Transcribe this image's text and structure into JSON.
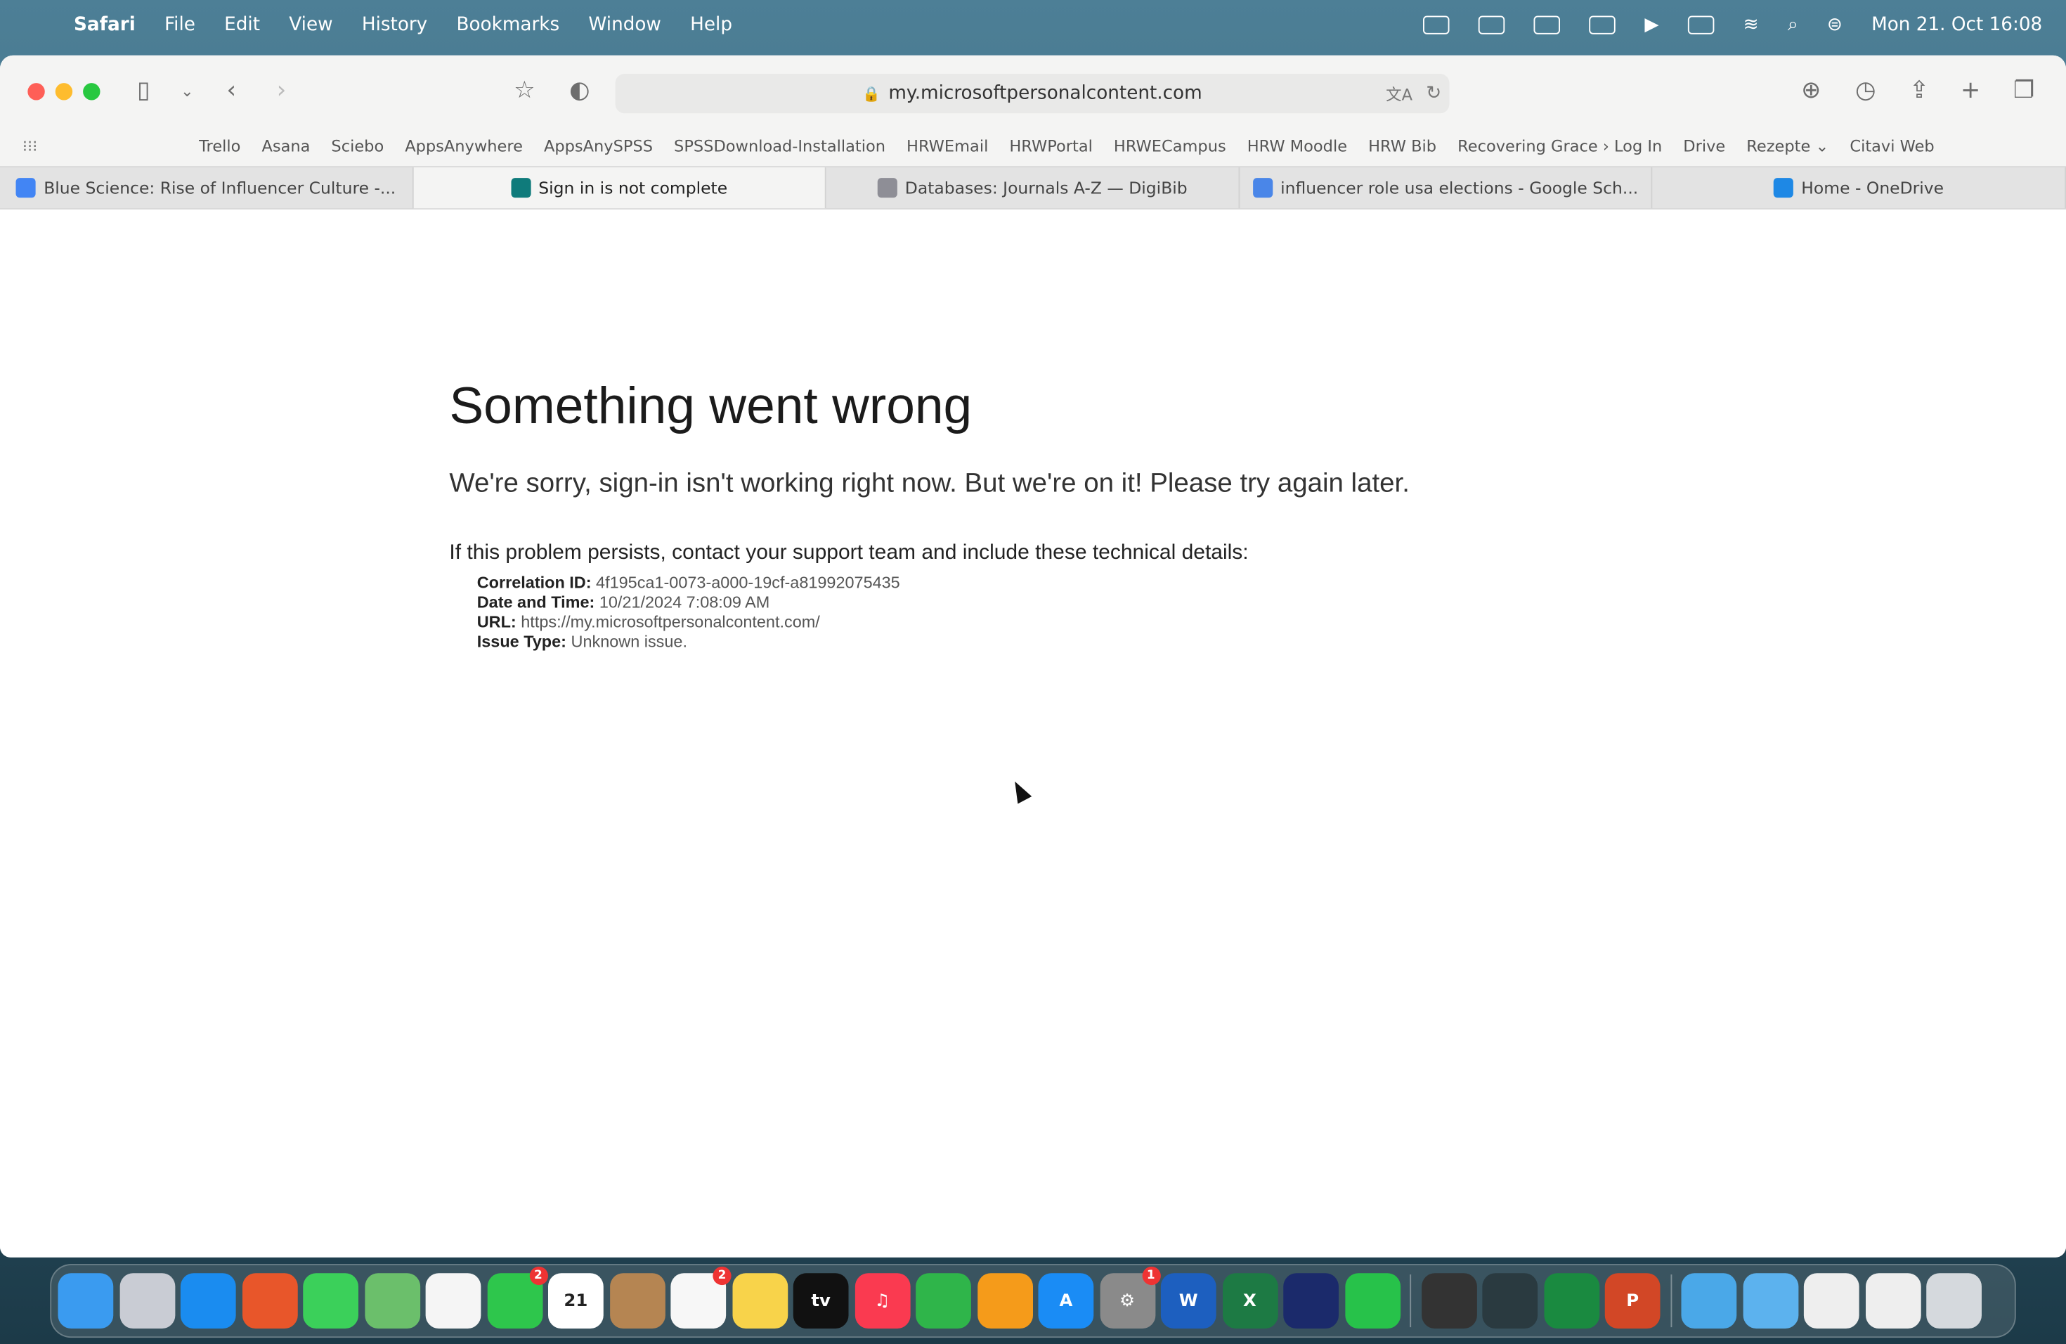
{
  "menubar": {
    "app": "Safari",
    "items": [
      "File",
      "Edit",
      "View",
      "History",
      "Bookmarks",
      "Window",
      "Help"
    ],
    "clock": "Mon 21. Oct  16:08"
  },
  "browser": {
    "url": "my.microsoftpersonalcontent.com",
    "bookmarks": [
      "Trello",
      "Asana",
      "Sciebo",
      "AppsAnywhere",
      "AppsAnySPSS",
      "SPSSDownload-Installation",
      "HRWEmail",
      "HRWPortal",
      "HRWECampus",
      "HRW Moodle",
      "HRW Bib",
      "Recovering Grace › Log In",
      "Drive",
      "Rezepte ⌄",
      "Citavi Web"
    ],
    "tabs": [
      {
        "title": "Blue Science: Rise of Influencer Culture -...",
        "color": "#4285f4",
        "active": false
      },
      {
        "title": "Sign in is not complete",
        "color": "#0f7b7b",
        "active": true
      },
      {
        "title": "Databases: Journals A-Z — DigiBib",
        "color": "#8e8e96",
        "active": false
      },
      {
        "title": "influencer role usa elections - Google Sch...",
        "color": "#4a86e8",
        "active": false
      },
      {
        "title": "Home - OneDrive",
        "color": "#1e88e5",
        "active": false
      }
    ]
  },
  "page": {
    "title": "Something went wrong",
    "subtitle": "We're sorry, sign-in isn't working right now. But we're on it! Please try again later.",
    "persist": "If this problem persists, contact your support team and include these technical details:",
    "details": [
      {
        "label": "Correlation ID:",
        "value": "4f195ca1-0073-a000-19cf-a81992075435"
      },
      {
        "label": "Date and Time:",
        "value": "10/21/2024 7:08:09 AM"
      },
      {
        "label": "URL:",
        "value": "https://my.microsoftpersonalcontent.com/"
      },
      {
        "label": "Issue Type:",
        "value": "Unknown issue."
      }
    ]
  },
  "dock": [
    {
      "name": "finder",
      "color": "#3a9bf0",
      "label": ""
    },
    {
      "name": "launchpad",
      "color": "#c9ccd4",
      "label": ""
    },
    {
      "name": "safari",
      "color": "#1a8cf0",
      "label": ""
    },
    {
      "name": "firefox",
      "color": "#e8562a",
      "label": ""
    },
    {
      "name": "messages",
      "color": "#3bd05a",
      "label": ""
    },
    {
      "name": "maps",
      "color": "#6bbf6b",
      "label": ""
    },
    {
      "name": "photos",
      "color": "#f5f5f5",
      "label": ""
    },
    {
      "name": "facetime",
      "color": "#2ec64c",
      "label": "",
      "badge": "2"
    },
    {
      "name": "calendar",
      "color": "#ffffff",
      "label": "21"
    },
    {
      "name": "contacts",
      "color": "#b58552",
      "label": ""
    },
    {
      "name": "reminders",
      "color": "#f7f7f7",
      "label": "",
      "badge": "2"
    },
    {
      "name": "notes",
      "color": "#f8d34a",
      "label": ""
    },
    {
      "name": "apple-tv",
      "color": "#111111",
      "label": "tv"
    },
    {
      "name": "music",
      "color": "#fa3a50",
      "label": "♫"
    },
    {
      "name": "numbers",
      "color": "#2fb54a",
      "label": ""
    },
    {
      "name": "pages",
      "color": "#f59b1a",
      "label": ""
    },
    {
      "name": "app-store",
      "color": "#1a8cf5",
      "label": "A"
    },
    {
      "name": "system-settings",
      "color": "#8a8a8a",
      "label": "⚙",
      "badge": "1"
    },
    {
      "name": "word",
      "color": "#1d5fbf",
      "label": "W"
    },
    {
      "name": "excel",
      "color": "#1d7a44",
      "label": "X"
    },
    {
      "name": "webex",
      "color": "#1b2a6b",
      "label": ""
    },
    {
      "name": "whatsapp",
      "color": "#27c24a",
      "label": ""
    },
    {
      "name": "keychain",
      "color": "#333333",
      "label": ""
    },
    {
      "name": "app",
      "color": "#2a3a40",
      "label": ""
    },
    {
      "name": "citavi",
      "color": "#1a8a40",
      "label": ""
    },
    {
      "name": "powerpoint",
      "color": "#d24726",
      "label": "P"
    },
    {
      "name": "downloads",
      "color": "#4aa8e8",
      "label": ""
    },
    {
      "name": "folder",
      "color": "#5cb2ee",
      "label": ""
    },
    {
      "name": "window-preview",
      "color": "#eeeeee",
      "label": ""
    },
    {
      "name": "window-preview-2",
      "color": "#eeeeee",
      "label": ""
    },
    {
      "name": "trash",
      "color": "#d5d9dd",
      "label": ""
    }
  ]
}
